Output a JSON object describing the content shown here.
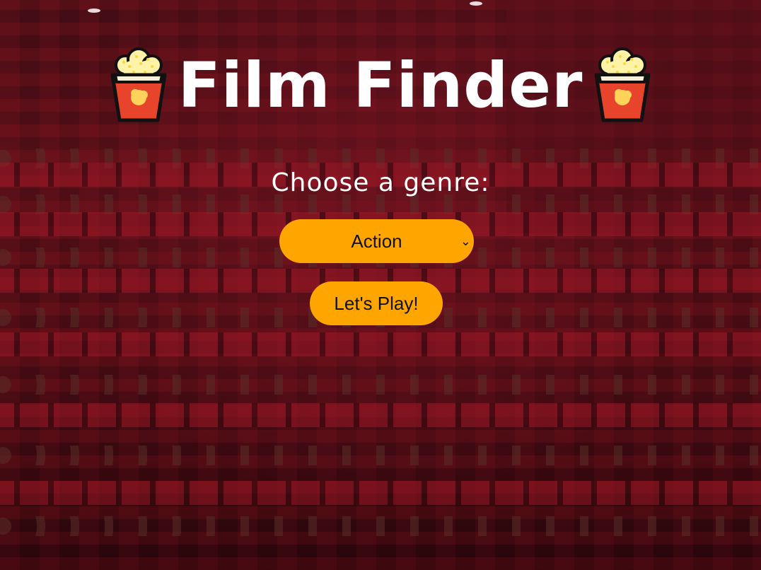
{
  "header": {
    "title": "Film Finder",
    "left_icon": "popcorn-icon",
    "right_icon": "popcorn-icon"
  },
  "genre": {
    "label": "Choose a genre:",
    "selected": "Action"
  },
  "play_button": {
    "label": "Let's Play!"
  },
  "colors": {
    "accent": "#ffa500",
    "title_text": "#ffffff",
    "background_tint": "#4a0e16"
  }
}
